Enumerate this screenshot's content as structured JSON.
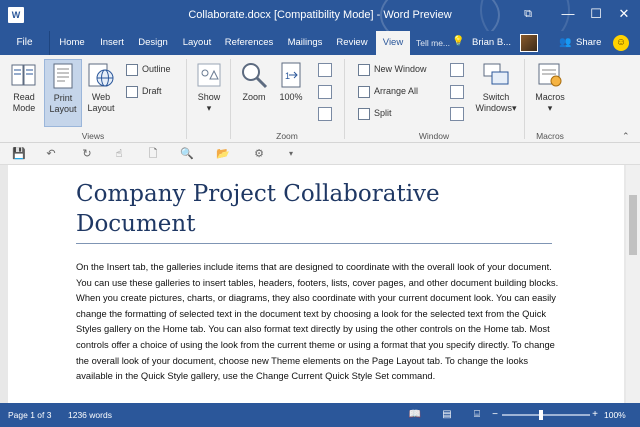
{
  "window": {
    "title": "Collaborate.docx [Compatibility Mode] - Word Preview",
    "app_icon": "W",
    "controls": {
      "restore": "⧉",
      "minimize": "—",
      "maximize": "☐",
      "close": "✕"
    }
  },
  "ribbon_tabs": {
    "file": "File",
    "tabs": [
      "Home",
      "Insert",
      "Design",
      "Layout",
      "References",
      "Mailings",
      "Review",
      "View"
    ],
    "active": "View",
    "tell_me": "Tell me...",
    "user": "Brian B...",
    "share": "Share"
  },
  "ribbon": {
    "views": {
      "label": "Views",
      "read_mode": [
        "Read",
        "Mode"
      ],
      "print_layout": [
        "Print",
        "Layout"
      ],
      "web_layout": [
        "Web",
        "Layout"
      ],
      "outline": "Outline",
      "draft": "Draft"
    },
    "show": {
      "label": "Show"
    },
    "zoom": {
      "label": "Zoom",
      "zoom": "Zoom",
      "percent": "100%"
    },
    "window": {
      "label": "Window",
      "new_window": "New Window",
      "arrange_all": "Arrange All",
      "split": "Split",
      "switch_windows": [
        "Switch",
        "Windows"
      ]
    },
    "macros": {
      "label": "Macros",
      "macros": "Macros"
    }
  },
  "document": {
    "title": "Company Project Collaborative Document",
    "body": "On the Insert tab, the galleries include items that are designed to coordinate with the overall look of your document. You can use these galleries to insert tables, headers, footers, lists, cover pages, and other document building blocks. When you create pictures, charts, or diagrams, they also coordinate with your current document look. You can easily change the formatting of selected text in the document text by choosing a look for the selected text from the Quick Styles gallery on the Home tab. You can also format text directly by using the other controls on the Home tab. Most controls offer a choice of using the look from the current theme or using a format that you specify directly. To change the overall look of your document, choose new Theme elements on the Page Layout tab. To change the looks available in the Quick Style gallery, use the Change Current Quick Style Set command."
  },
  "status": {
    "page": "Page 1 of 3",
    "words": "1236 words",
    "zoom": "100%",
    "zoom_level_percent": 100
  },
  "colors": {
    "accent": "#2b579a",
    "ribbon_bg": "#f3f3f3",
    "title_text": "#1f3864"
  }
}
